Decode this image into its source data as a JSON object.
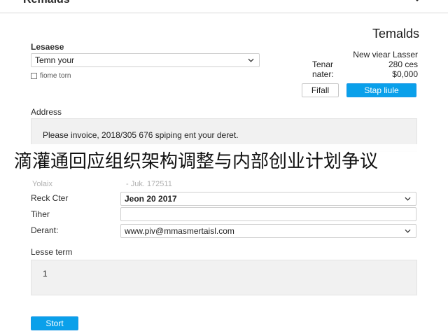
{
  "window": {
    "title": "Remalds"
  },
  "left_form": {
    "lease_label": "Lesaese",
    "lease_select_value": "Temn your",
    "checkbox_label": "fiome torn"
  },
  "right_panel": {
    "title": "Temalds",
    "line1": "New viear Lasser",
    "row1_key": "Tenar",
    "row1_value": "280 ces",
    "row2_key": "nater:",
    "row2_value": "$0,000",
    "secondary_button": "Fifall",
    "primary_button": "Stap liule"
  },
  "address": {
    "label": "Address",
    "value": "Please invoice, 2018/305 676 spiping ent your deret."
  },
  "overlay": {
    "text": "滴灌通回应组织架构调整与内部创业计划争议"
  },
  "ghost": {
    "left": "Yolaix",
    "right": "- Juk. 172511"
  },
  "fields": {
    "reck_label": "Reck Cter",
    "reck_value": "Jeon 20 2017",
    "tiher_label": "Tiher",
    "tiher_value": "",
    "derant_label": "Derant:",
    "derant_value": "www.piv@mmasmertaisl.com"
  },
  "lesse_term": {
    "label": "Lesse term",
    "value": "1"
  },
  "actions": {
    "start_label": "Stort"
  },
  "colors": {
    "primary": "#0aa0ea",
    "border": "#cfcfcf",
    "box_bg": "#f1f1f1"
  },
  "icons": {
    "top_chevron": "chevron-down-icon",
    "select_caret": "chevron-down-icon"
  }
}
